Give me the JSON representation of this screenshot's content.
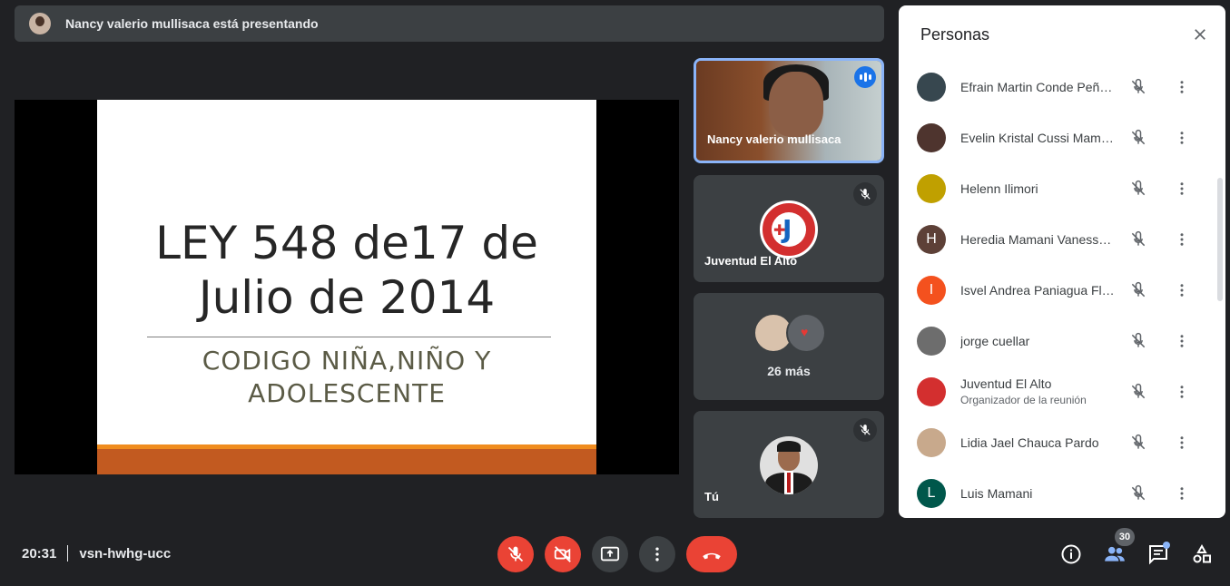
{
  "banner": {
    "text": "Nancy valerio mullisaca está presentando"
  },
  "slide": {
    "title_line1": "LEY 548 de17 de",
    "title_line2": "Julio de 2014",
    "subtitle_line1": "CODIGO NIÑA,NIÑO Y",
    "subtitle_line2": "ADOLESCENTE"
  },
  "tiles": {
    "presenter": "Nancy valerio mullisaca",
    "org": "Juventud El Alto",
    "more": "26 más",
    "self": "Tú"
  },
  "panel": {
    "title": "Personas",
    "participants": [
      {
        "name": "Efrain Martin Conde Peña...",
        "initial": "",
        "color": "#37474f"
      },
      {
        "name": "Evelin Kristal Cussi Mamani",
        "initial": "",
        "color": "#4e342e"
      },
      {
        "name": "Helenn Ilimori",
        "initial": "",
        "color": "#c0a000"
      },
      {
        "name": "Heredia Mamani Vanessa ...",
        "initial": "H",
        "color": "#5d4037"
      },
      {
        "name": "Isvel Andrea Paniagua Flo...",
        "initial": "I",
        "color": "#f4511e"
      },
      {
        "name": "jorge cuellar",
        "initial": "",
        "color": "#6d6d6d"
      },
      {
        "name": "Juventud El Alto",
        "subtitle": "Organizador de la reunión",
        "initial": "",
        "color": "#d32f2f"
      },
      {
        "name": "Lidia Jael Chauca Pardo",
        "initial": "",
        "color": "#c8a98c"
      },
      {
        "name": "Luis Mamani",
        "initial": "L",
        "color": "#00574b"
      }
    ]
  },
  "meeting": {
    "time": "20:31",
    "code": "vsn-hwhg-ucc"
  },
  "people_count": "30",
  "colors": {
    "accent": "#8ab4f8",
    "danger": "#ea4335",
    "background": "#202124",
    "tile": "#3c4043"
  }
}
